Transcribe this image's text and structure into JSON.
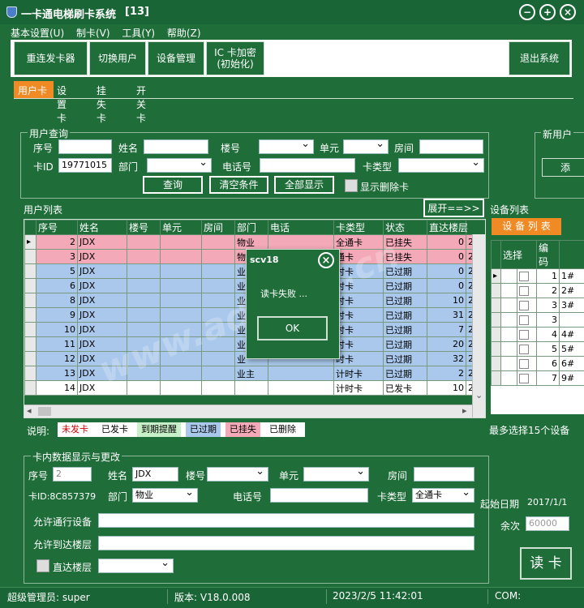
{
  "app": {
    "title": "一卡通电梯刷卡系统",
    "version_tag": "[13]"
  },
  "menu": [
    "基本设置(U)",
    "制卡(V)",
    "工具(Y)",
    "帮助(Z)"
  ],
  "toolbar": {
    "reissue": "重连发卡器",
    "switch_user": "切换用户",
    "device_mgmt": "设备管理",
    "ic_encrypt_1": "IC 卡加密",
    "ic_encrypt_2": "(初始化)",
    "exit": "退出系统"
  },
  "tabs": [
    "用户卡",
    "设置卡",
    "挂失卡",
    "开关卡"
  ],
  "query": {
    "title": "用户查询",
    "seq": "序号",
    "name": "姓名",
    "building": "楼号",
    "unit": "单元",
    "room": "房间",
    "card_id": "卡ID",
    "card_id_value": "19771015",
    "dept": "部门",
    "phone": "电话号",
    "card_type": "卡类型",
    "btn_query": "查询",
    "btn_clear": "清空条件",
    "btn_all": "全部显示",
    "show_deleted": "显示删除卡"
  },
  "new_user": {
    "title": "新用户",
    "btn": "添"
  },
  "user_list": {
    "title": "用户列表",
    "expand": "展开==>>",
    "headers": [
      "序号",
      "姓名",
      "楼号",
      "单元",
      "房间",
      "部门",
      "电话",
      "卡类型",
      "状态",
      "直达楼层",
      ""
    ],
    "rows": [
      {
        "seq": "2",
        "name": "JDX",
        "dept": "物业",
        "type": "全通卡",
        "status": "已挂失",
        "floor": "0",
        "x": "2",
        "color": "#f4a9b8"
      },
      {
        "seq": "3",
        "name": "JDX",
        "dept": "物",
        "type": "通卡",
        "status": "已挂失",
        "floor": "0",
        "x": "2",
        "color": "#f4a9b8"
      },
      {
        "seq": "5",
        "name": "JDX",
        "dept": "业",
        "type": "时卡",
        "status": "已过期",
        "floor": "0",
        "x": "2",
        "color": "#a9c8ec"
      },
      {
        "seq": "6",
        "name": "JDX",
        "dept": "业",
        "type": "时卡",
        "status": "已过期",
        "floor": "0",
        "x": "2",
        "color": "#a9c8ec"
      },
      {
        "seq": "8",
        "name": "JDX",
        "dept": "业",
        "type": "时卡",
        "status": "已过期",
        "floor": "10",
        "x": "2",
        "color": "#a9c8ec"
      },
      {
        "seq": "9",
        "name": "JDX",
        "dept": "业",
        "type": "时卡",
        "status": "已过期",
        "floor": "31",
        "x": "2",
        "color": "#a9c8ec"
      },
      {
        "seq": "10",
        "name": "JDX",
        "dept": "业",
        "type": "时卡",
        "status": "已过期",
        "floor": "7",
        "x": "2",
        "color": "#a9c8ec"
      },
      {
        "seq": "11",
        "name": "JDX",
        "dept": "业",
        "type": "时卡",
        "status": "已过期",
        "floor": "20",
        "x": "2",
        "color": "#a9c8ec"
      },
      {
        "seq": "12",
        "name": "JDX",
        "dept": "业",
        "type": "时卡",
        "status": "已过期",
        "floor": "32",
        "x": "2",
        "color": "#a9c8ec"
      },
      {
        "seq": "13",
        "name": "JDX",
        "dept": "业主",
        "type": "计时卡",
        "status": "已过期",
        "floor": "2",
        "x": "2",
        "color": "#a9c8ec"
      },
      {
        "seq": "14",
        "name": "JDX",
        "dept": "",
        "type": "计时卡",
        "status": "已发卡",
        "floor": "10",
        "x": "2",
        "color": "#ffffff"
      }
    ]
  },
  "legend": {
    "label": "说明:",
    "items": [
      {
        "text": "未发卡",
        "fg": "#d00000",
        "bg": "#ffffff"
      },
      {
        "text": "已发卡",
        "fg": "#000000",
        "bg": "#ffffff"
      },
      {
        "text": "到期提醒",
        "fg": "#000000",
        "bg": "#c8f0c8"
      },
      {
        "text": "已过期",
        "fg": "#000000",
        "bg": "#a9c8ec"
      },
      {
        "text": "已挂失",
        "fg": "#000000",
        "bg": "#f4a9b8"
      },
      {
        "text": "已删除",
        "fg": "#000000",
        "bg": "#ffffff"
      }
    ]
  },
  "device_list": {
    "title": "设备列表",
    "header_btn": "设 备 列 表",
    "col_select": "选择",
    "col_code": "编码",
    "rows": [
      {
        "code": "1",
        "name": "1#"
      },
      {
        "code": "2",
        "name": "2#"
      },
      {
        "code": "3",
        "name": "3#"
      },
      {
        "code": "3",
        "name": ""
      },
      {
        "code": "4",
        "name": "4#"
      },
      {
        "code": "5",
        "name": "5#"
      },
      {
        "code": "6",
        "name": "6#"
      },
      {
        "code": "7",
        "name": "9#"
      }
    ],
    "max_note": "最多选择15个设备"
  },
  "card_data": {
    "title": "卡内数据显示与更改",
    "seq": "序号",
    "seq_value": "2",
    "name": "姓名",
    "name_value": "JDX",
    "building": "楼号",
    "unit": "单元",
    "room": "房间",
    "card_id": "卡ID:8C857379",
    "dept": "部门",
    "dept_value": "物业",
    "phone": "电话号",
    "card_type": "卡类型",
    "card_type_value": "全通卡",
    "start_date": "起始日期",
    "start_date_value": "2017/1/1",
    "allowed_devices": "允许通行设备",
    "allowed_floors": "允许到达楼层",
    "direct_floor": "直达楼层",
    "balance": "余次",
    "balance_value": "60000",
    "read_btn": "读 卡"
  },
  "dialog": {
    "title": "scv18",
    "message": "读卡失败 ...",
    "ok": "OK"
  },
  "watermark": "www.admin5.cn",
  "status": {
    "user": "超级管理员: super",
    "version": "版本: V18.0.008",
    "time": "2023/2/5 11:42:01",
    "com": "COM:"
  }
}
